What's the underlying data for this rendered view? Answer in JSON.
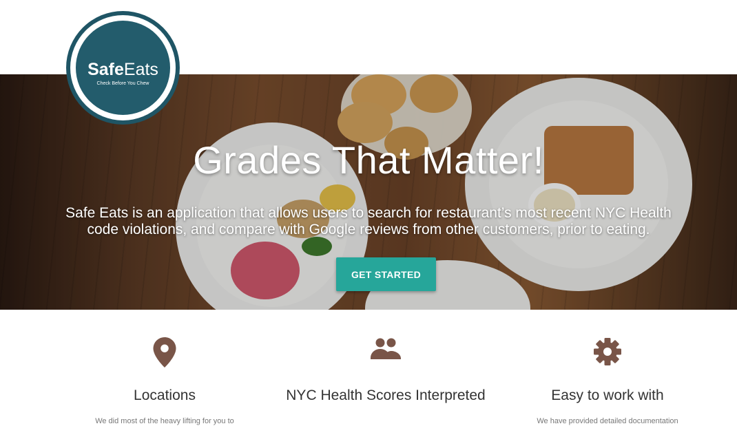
{
  "logo": {
    "name_bold": "Safe",
    "name_light": "Eats",
    "tagline": "Check Before You Chew"
  },
  "hero": {
    "title": "Grades That Matter!",
    "description": "Safe Eats is an application that allows users to search for restaurant’s most recent NYC Health code violations, and compare with Google reviews from other customers, prior to eating.",
    "cta_label": "GET STARTED"
  },
  "colors": {
    "accent": "#26a69a",
    "icon": "#795548",
    "logo": "#235c6c"
  },
  "features": [
    {
      "icon": "location-pin-icon",
      "title": "Locations",
      "text": "We did most of the heavy lifting for you to"
    },
    {
      "icon": "people-icon",
      "title": "NYC Health Scores Interpreted",
      "text": ""
    },
    {
      "icon": "gear-icon",
      "title": "Easy to work with",
      "text": "We have provided detailed documentation"
    }
  ]
}
